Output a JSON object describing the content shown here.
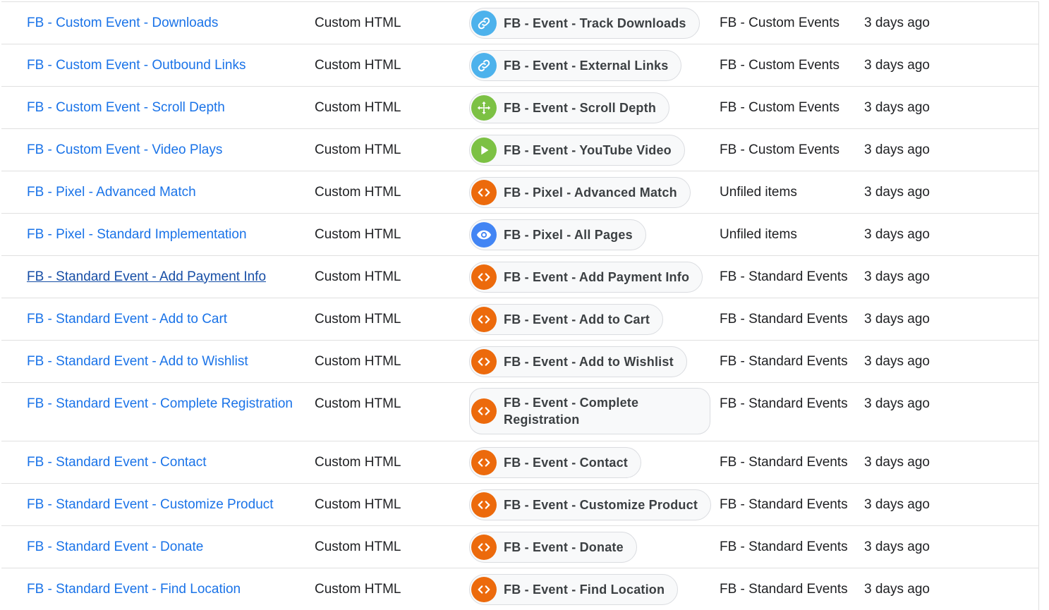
{
  "colors": {
    "link": "#1a73e8",
    "link_visited": "#174ea6",
    "blue_icon": "#4db2ec",
    "green_icon": "#7cc144",
    "orange_icon": "#ec6a0c",
    "dark_blue_icon": "#4285f4"
  },
  "rows": [
    {
      "name": "FB - Custom Event - Downloads",
      "type": "Custom HTML",
      "trigger": "FB - Event - Track Downloads",
      "trigger_icon": "link-icon",
      "folder": "FB - Custom Events",
      "edited": "3 days ago"
    },
    {
      "name": "FB - Custom Event - Outbound Links",
      "type": "Custom HTML",
      "trigger": "FB - Event - External Links",
      "trigger_icon": "link-icon",
      "folder": "FB - Custom Events",
      "edited": "3 days ago"
    },
    {
      "name": "FB - Custom Event - Scroll Depth",
      "type": "Custom HTML",
      "trigger": "FB - Event - Scroll Depth",
      "trigger_icon": "move-icon",
      "folder": "FB - Custom Events",
      "edited": "3 days ago"
    },
    {
      "name": "FB - Custom Event - Video Plays",
      "type": "Custom HTML",
      "trigger": "FB - Event - YouTube Video",
      "trigger_icon": "play-icon",
      "folder": "FB - Custom Events",
      "edited": "3 days ago"
    },
    {
      "name": "FB - Pixel - Advanced Match",
      "type": "Custom HTML",
      "trigger": "FB - Pixel - Advanced Match",
      "trigger_icon": "code-icon",
      "folder": "Unfiled items",
      "edited": "3 days ago"
    },
    {
      "name": "FB - Pixel - Standard Implementation",
      "type": "Custom HTML",
      "trigger": "FB - Pixel - All Pages",
      "trigger_icon": "eye-icon",
      "folder": "Unfiled items",
      "edited": "3 days ago"
    },
    {
      "name": "FB - Standard Event - Add Payment Info",
      "type": "Custom HTML",
      "trigger": "FB - Event - Add Payment Info",
      "trigger_icon": "code-icon",
      "folder": "FB - Standard Events",
      "edited": "3 days ago"
    },
    {
      "name": "FB - Standard Event - Add to Cart",
      "type": "Custom HTML",
      "trigger": "FB - Event - Add to Cart",
      "trigger_icon": "code-icon",
      "folder": "FB - Standard Events",
      "edited": "3 days ago"
    },
    {
      "name": "FB - Standard Event - Add to Wishlist",
      "type": "Custom HTML",
      "trigger": "FB - Event - Add to Wishlist",
      "trigger_icon": "code-icon",
      "folder": "FB - Standard Events",
      "edited": "3 days ago"
    },
    {
      "name": "FB - Standard Event - Complete Registration",
      "type": "Custom HTML",
      "trigger": "FB - Event - Complete Registration",
      "trigger_icon": "code-icon",
      "folder": "FB - Standard Events",
      "edited": "3 days ago"
    },
    {
      "name": "FB - Standard Event - Contact",
      "type": "Custom HTML",
      "trigger": "FB - Event - Contact",
      "trigger_icon": "code-icon",
      "folder": "FB - Standard Events",
      "edited": "3 days ago"
    },
    {
      "name": "FB - Standard Event - Customize Product",
      "type": "Custom HTML",
      "trigger": "FB - Event - Customize Product",
      "trigger_icon": "code-icon",
      "folder": "FB - Standard Events",
      "edited": "3 days ago"
    },
    {
      "name": "FB - Standard Event - Donate",
      "type": "Custom HTML",
      "trigger": "FB - Event - Donate",
      "trigger_icon": "code-icon",
      "folder": "FB - Standard Events",
      "edited": "3 days ago"
    },
    {
      "name": "FB - Standard Event - Find Location",
      "type": "Custom HTML",
      "trigger": "FB - Event - Find Location",
      "trigger_icon": "code-icon",
      "folder": "FB - Standard Events",
      "edited": "3 days ago"
    }
  ]
}
